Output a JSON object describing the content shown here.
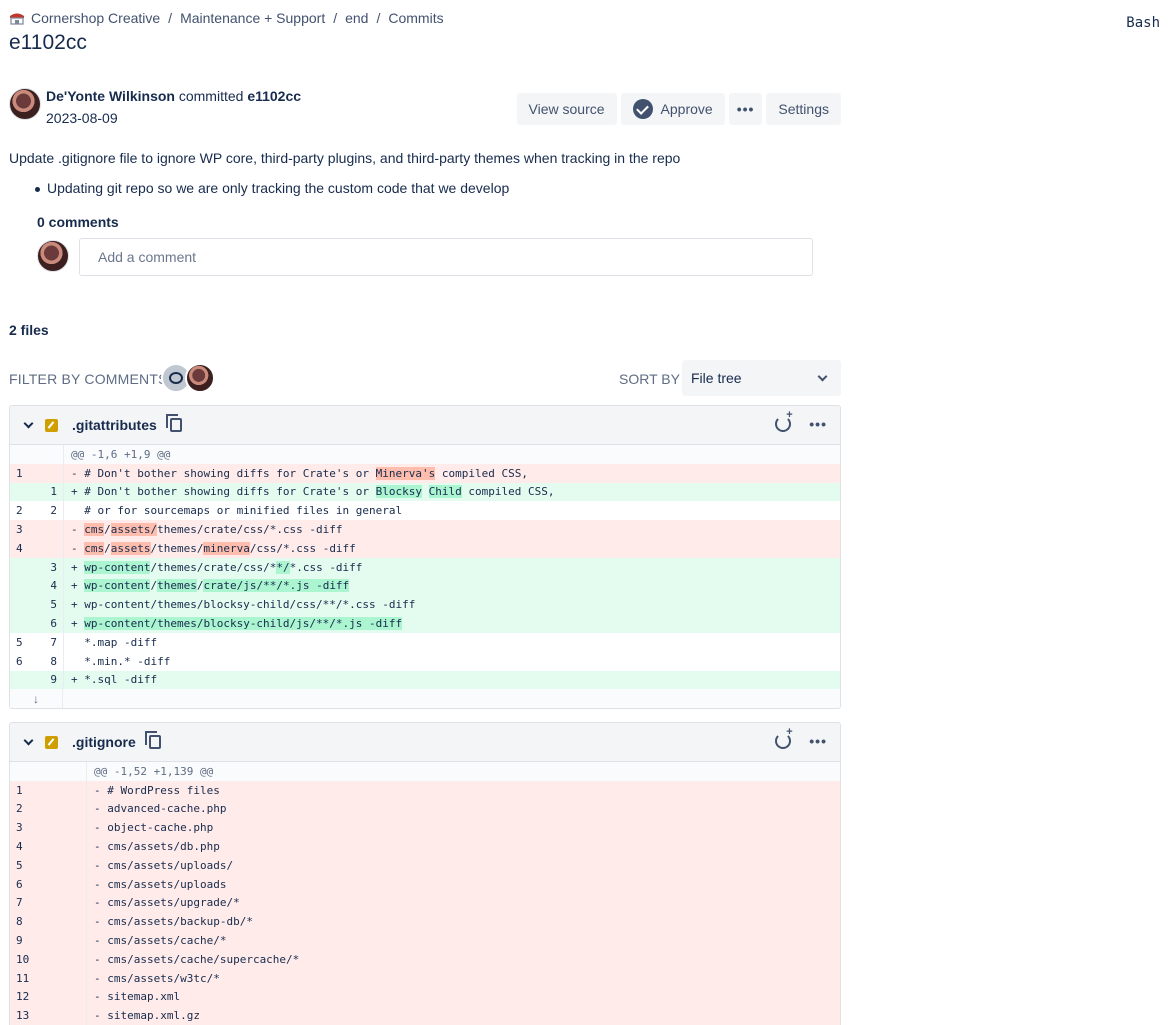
{
  "breadcrumb": {
    "workspace": "Cornershop Creative",
    "project": "Maintenance + Support",
    "repo": "end",
    "section": "Commits",
    "separator": "/"
  },
  "page": {
    "title": "e1102cc",
    "lang_tag": "Bash"
  },
  "commit": {
    "author": "De'Yonte Wilkinson",
    "verb": "committed",
    "hash": "e1102cc",
    "date": "2023-08-09",
    "message": "Update .gitignore file to ignore WP core, third-party plugins, and third-party themes when tracking in the repo",
    "bullets": [
      "Updating git repo so we are only tracking the custom code that we develop"
    ]
  },
  "actions": {
    "view_source": "View source",
    "approve": "Approve",
    "more": "•••",
    "settings": "Settings"
  },
  "comments": {
    "count_label": "0 comments",
    "placeholder": "Add a comment"
  },
  "files": {
    "count_label": "2 files",
    "filter_label": "FILTER BY COMMENTS",
    "sort_label": "SORT BY",
    "sort_value": "File tree"
  },
  "file1": {
    "name": ".gitattributes",
    "hunk": "@@ -1,6 +1,9 @@",
    "lines": [
      {
        "type": "del",
        "o": "1",
        "n": "",
        "segs": [
          [
            "- # Don't bother showing diffs for Crate's or ",
            ""
          ],
          [
            "Minerva's",
            "del"
          ],
          [
            " compiled CSS,",
            ""
          ]
        ]
      },
      {
        "type": "add",
        "o": "",
        "n": "1",
        "segs": [
          [
            "+ # Don't bother showing diffs for Crate's or ",
            ""
          ],
          [
            "Blocksy",
            "add"
          ],
          [
            " ",
            ""
          ],
          [
            "Child",
            "add"
          ],
          [
            " compiled CSS,",
            ""
          ]
        ]
      },
      {
        "type": "ctx",
        "o": "2",
        "n": "2",
        "segs": [
          [
            "  # or for sourcemaps or minified files in general",
            ""
          ]
        ]
      },
      {
        "type": "del",
        "o": "3",
        "n": "",
        "segs": [
          [
            "- ",
            ""
          ],
          [
            "cms",
            "del"
          ],
          [
            "/",
            ""
          ],
          [
            "assets/",
            "del"
          ],
          [
            "themes/crate/css/*.css -diff",
            ""
          ]
        ]
      },
      {
        "type": "del",
        "o": "4",
        "n": "",
        "segs": [
          [
            "- ",
            ""
          ],
          [
            "cms",
            "del"
          ],
          [
            "/",
            ""
          ],
          [
            "assets",
            "del"
          ],
          [
            "/themes/",
            ""
          ],
          [
            "minerva",
            "del"
          ],
          [
            "/css/*.css -diff",
            ""
          ]
        ]
      },
      {
        "type": "add",
        "o": "",
        "n": "3",
        "segs": [
          [
            "+ ",
            ""
          ],
          [
            "wp-content",
            "add"
          ],
          [
            "/themes/crate/css/*",
            ""
          ],
          [
            "*/",
            "add"
          ],
          [
            "*.css -diff",
            ""
          ]
        ]
      },
      {
        "type": "add",
        "o": "",
        "n": "4",
        "segs": [
          [
            "+ ",
            ""
          ],
          [
            "wp-content",
            "add"
          ],
          [
            "/",
            ""
          ],
          [
            "themes",
            "add"
          ],
          [
            "/",
            ""
          ],
          [
            "crate/js/**/*.js -diff",
            "add"
          ]
        ]
      },
      {
        "type": "add",
        "o": "",
        "n": "5",
        "segs": [
          [
            "+ wp-content/themes/blocksy-child/css/**/*.css -diff",
            ""
          ]
        ]
      },
      {
        "type": "add",
        "o": "",
        "n": "6",
        "segs": [
          [
            "+ ",
            ""
          ],
          [
            "wp-content/themes/blocksy-child/js/**/*.js -diff",
            "add"
          ]
        ]
      },
      {
        "type": "ctx",
        "o": "5",
        "n": "7",
        "segs": [
          [
            "  *.map -diff",
            ""
          ]
        ]
      },
      {
        "type": "ctx",
        "o": "6",
        "n": "8",
        "segs": [
          [
            "  *.min.* -diff",
            ""
          ]
        ]
      },
      {
        "type": "add",
        "o": "",
        "n": "9",
        "segs": [
          [
            "+ *.sql -diff",
            ""
          ]
        ]
      }
    ],
    "expand": "↓"
  },
  "file2": {
    "name": ".gitignore",
    "hunk": "@@ -1,52 +1,139 @@",
    "lines": [
      {
        "o": "1",
        "text": "- # WordPress files"
      },
      {
        "o": "2",
        "text": "- advanced-cache.php"
      },
      {
        "o": "3",
        "text": "- object-cache.php"
      },
      {
        "o": "4",
        "text": "- cms/assets/db.php"
      },
      {
        "o": "5",
        "text": "- cms/assets/uploads/"
      },
      {
        "o": "6",
        "text": "- cms/assets/uploads"
      },
      {
        "o": "7",
        "text": "- cms/assets/upgrade/*"
      },
      {
        "o": "8",
        "text": "- cms/assets/backup-db/*"
      },
      {
        "o": "9",
        "text": "- cms/assets/cache/*"
      },
      {
        "o": "10",
        "text": "- cms/assets/cache/supercache/*"
      },
      {
        "o": "11",
        "text": "- cms/assets/w3tc/*"
      },
      {
        "o": "12",
        "text": "- sitemap.xml"
      },
      {
        "o": "13",
        "text": "- sitemap.xml.gz"
      }
    ]
  },
  "colors": {
    "del_bg": "#ffebe9",
    "add_bg": "#e3fcef",
    "del_hl": "#ffbdad",
    "add_hl": "#abf5d1",
    "mod_icon": "#cf9f02"
  }
}
